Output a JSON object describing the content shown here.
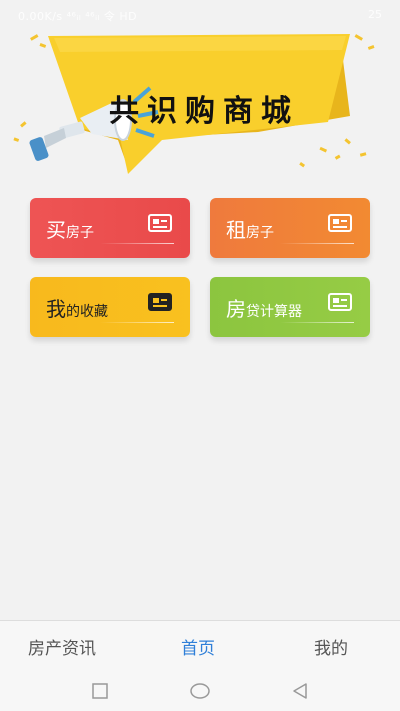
{
  "status_bar": {
    "left_text": "0.00K/s  ⁴⁶ᵢₗ  ⁴⁶ᵢₗ  令  HD",
    "right_text": "25"
  },
  "banner": {
    "title": "共识购商城"
  },
  "cards": [
    {
      "main": "买",
      "sub": "房子"
    },
    {
      "main": "租",
      "sub": "房子"
    },
    {
      "main": "我",
      "sub": "的收藏"
    },
    {
      "main": "房",
      "sub": "贷计算器"
    }
  ],
  "tabs": [
    {
      "label": "房产资讯"
    },
    {
      "label": "首页",
      "active": true
    },
    {
      "label": "我的"
    }
  ],
  "colors": {
    "active_tab": "#2f7fd8",
    "banner_yellow": "#f9cf2c",
    "card_buy": "#ee5454",
    "card_rent": "#ef7a3d",
    "card_fav": "#f8b91d",
    "card_calc": "#8cc53f"
  }
}
